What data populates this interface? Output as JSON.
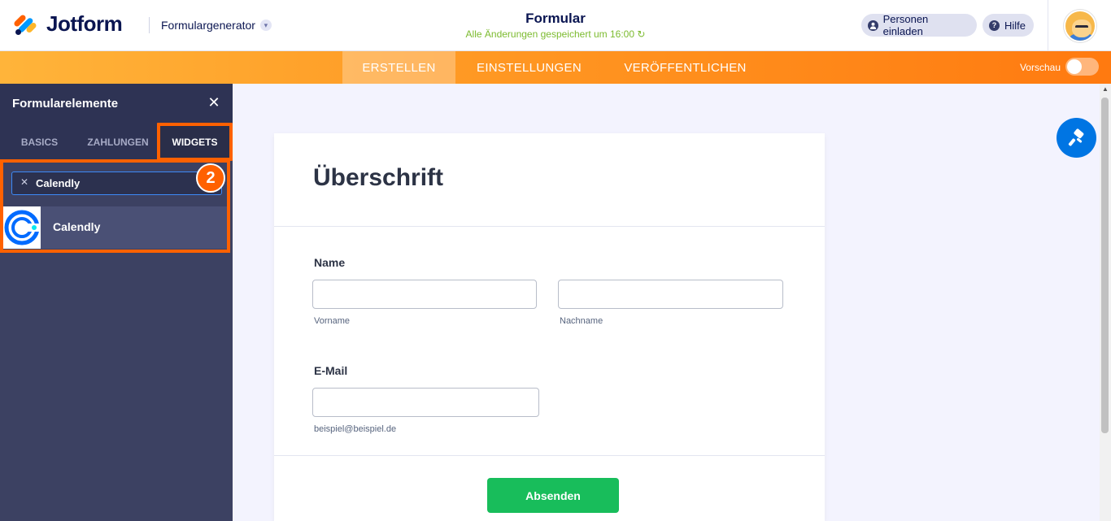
{
  "header": {
    "logo_text": "Jotform",
    "generator": "Formulargenerator",
    "form_title": "Formular",
    "save_status": "Alle Änderungen gespeichert um 16:00",
    "invite_label": "Personen einladen",
    "help_label": "Hilfe"
  },
  "nav": {
    "tabs": [
      "ERSTELLEN",
      "EINSTELLUNGEN",
      "VERÖFFENTLICHEN"
    ],
    "active_tab": "ERSTELLEN",
    "preview_label": "Vorschau",
    "preview_enabled": false
  },
  "panel": {
    "title": "Formularelemente",
    "tabs": [
      "BASICS",
      "ZAHLUNGEN",
      "WIDGETS"
    ],
    "active_tab": "WIDGETS",
    "search_value": "Calendly",
    "step_badge": "2",
    "results": [
      {
        "label": "Calendly"
      }
    ]
  },
  "form": {
    "heading": "Überschrift",
    "name_label": "Name",
    "first_sublabel": "Vorname",
    "last_sublabel": "Nachname",
    "email_label": "E-Mail",
    "email_sublabel": "beispiel@beispiel.de",
    "submit_label": "Absenden"
  },
  "colors": {
    "accent": "#ff6100",
    "submit": "#18bd5b",
    "panel_bg": "#3c4162",
    "fab": "#0075e3",
    "save_status": "#7cbb2f"
  },
  "icons": {
    "help": "question-circle-icon",
    "invite": "user-icon",
    "close": "close-icon",
    "search_clear": "clear-icon",
    "fab": "paint-roller-icon",
    "result": "calendly-logo-icon"
  }
}
